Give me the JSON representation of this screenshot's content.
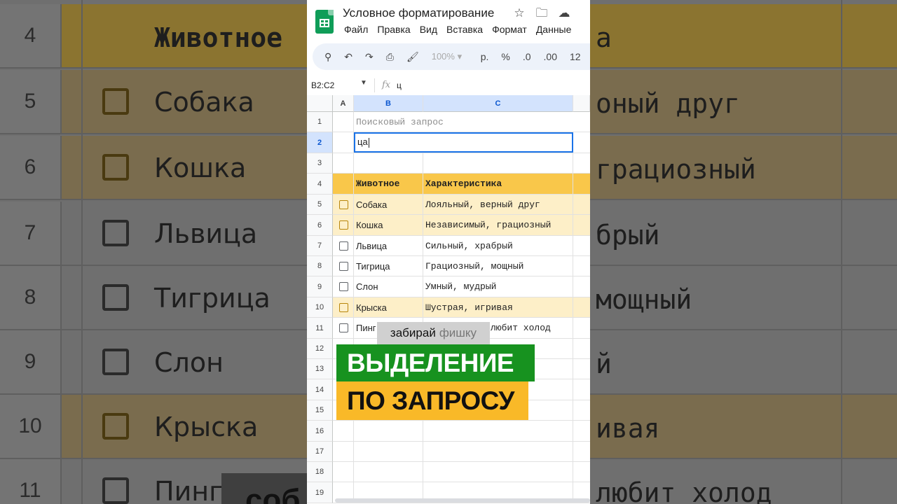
{
  "doc": {
    "title": "Условное форматирование",
    "menu": [
      "Файл",
      "Правка",
      "Вид",
      "Вставка",
      "Формат",
      "Данные"
    ],
    "zoom": "100%",
    "toolbar": {
      "currency": "р.",
      "percent": "%",
      "dec_minus": ".0",
      "dec_plus": ".00",
      "num": "12"
    },
    "namebox": "B2:C2",
    "formula_symbol": "fx",
    "formula_value": "ц"
  },
  "grid": {
    "columns": [
      "A",
      "B",
      "C"
    ],
    "rows": [
      "1",
      "2",
      "3",
      "4",
      "5",
      "6",
      "7",
      "8",
      "9",
      "10",
      "11",
      "12",
      "13",
      "14",
      "15",
      "16",
      "17",
      "18",
      "19"
    ],
    "search_label": "Поисковый запрос",
    "search_value": "ца",
    "header": {
      "animal": "Животное",
      "trait": "Характеристика"
    },
    "items": [
      {
        "animal": "Собака",
        "trait": "Лояльный, верный друг",
        "highlighted": true
      },
      {
        "animal": "Кошка",
        "trait": "Независимый, грациозный",
        "highlighted": true
      },
      {
        "animal": "Львица",
        "trait": "Сильный, храбрый",
        "highlighted": false
      },
      {
        "animal": "Тигрица",
        "trait": "Грациозный, мощный",
        "highlighted": false
      },
      {
        "animal": "Слон",
        "trait": "Умный, мудрый",
        "highlighted": false
      },
      {
        "animal": "Крыска",
        "trait": "Шустрая, игривая",
        "highlighted": true
      },
      {
        "animal": "Пинг",
        "trait": "любит холод",
        "highlighted": false
      }
    ]
  },
  "background": {
    "rows": [
      {
        "num": "4",
        "left": "Животное",
        "right": "а"
      },
      {
        "num": "5",
        "left": "Собака",
        "right": "оный друг"
      },
      {
        "num": "6",
        "left": "Кошка",
        "right": "грациозный"
      },
      {
        "num": "7",
        "left": "Львица",
        "right": "брый"
      },
      {
        "num": "8",
        "left": "Тигрица",
        "right": "мощный"
      },
      {
        "num": "9",
        "left": "Слон",
        "right": "й"
      },
      {
        "num": "10",
        "left": "Крыска",
        "right": "ивая"
      },
      {
        "num": "11",
        "left": "Пинг",
        "right": "любит холод"
      }
    ],
    "blob_text": "соб"
  },
  "overlay": {
    "tag_a": "забирай",
    "tag_b": "фишку",
    "line1": "ВЫДЕЛЕНИЕ",
    "line2": "ПО ЗАПРОСУ"
  },
  "colors": {
    "green": "#17921f",
    "yellow": "#f9b928",
    "header_fill": "#f9c74a",
    "highlight_fill": "#fdefc8",
    "selection": "#1a73e8"
  }
}
